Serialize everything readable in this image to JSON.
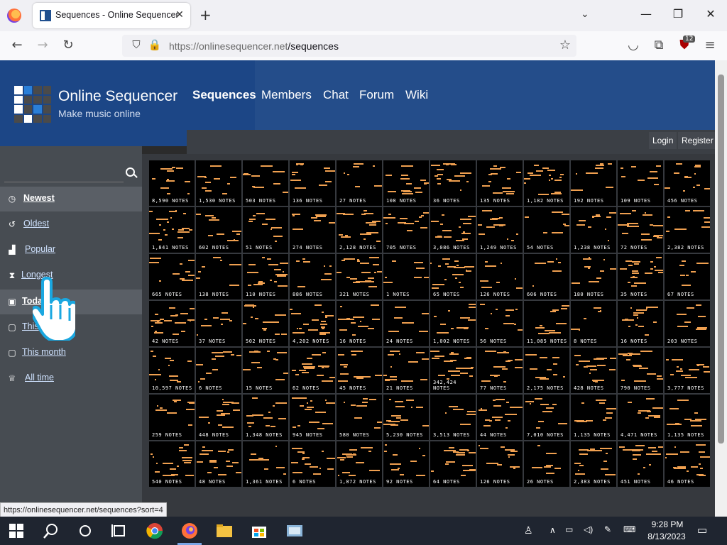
{
  "browser": {
    "tab_title": "Sequences - Online Sequencer",
    "url_host": "https://onlinesequencer.net",
    "url_path": "/sequences",
    "ext_badge": "12",
    "status_url": "https://onlinesequencer.net/sequences?sort=4"
  },
  "site": {
    "title": "Online Sequencer",
    "subtitle": "Make music online",
    "nav": [
      "Sequences",
      "Members",
      "Chat",
      "Forum",
      "Wiki"
    ],
    "login": "Login",
    "register": "Register"
  },
  "sidebar": {
    "search_placeholder": "",
    "items": [
      {
        "label": "Newest",
        "icon": "clock-icon",
        "selected": true
      },
      {
        "label": "Oldest",
        "icon": "history-icon",
        "selected": false
      },
      {
        "label": "Popular",
        "icon": "bar-chart-icon",
        "selected": false
      },
      {
        "label": "Longest",
        "icon": "hourglass-icon",
        "selected": false
      },
      {
        "label": "Today",
        "icon": "calendar-icon",
        "selected": true
      },
      {
        "label": "This",
        "icon": "calendar-icon",
        "selected": false
      },
      {
        "label": "This month",
        "icon": "calendar-icon",
        "selected": false
      },
      {
        "label": "All time",
        "icon": "trophy-icon",
        "selected": false
      }
    ]
  },
  "sequences": [
    "8,590 NOTES",
    "1,530 NOTES",
    "503 NOTES",
    "136 NOTES",
    "27 NOTES",
    "108 NOTES",
    "36 NOTES",
    "135 NOTES",
    "1,182 NOTES",
    "192 NOTES",
    "109 NOTES",
    "456 NOTES",
    "1,841 NOTES",
    "602 NOTES",
    "51 NOTES",
    "274 NOTES",
    "2,128 NOTES",
    "705 NOTES",
    "3,086 NOTES",
    "1,249 NOTES",
    "54 NOTES",
    "1,238 NOTES",
    "72 NOTES",
    "2,382 NOTES",
    "665 NOTES",
    "138 NOTES",
    "110 NOTES",
    "886 NOTES",
    "321 NOTES",
    "1 NOTES",
    "65 NOTES",
    "126 NOTES",
    "606 NOTES",
    "180 NOTES",
    "35 NOTES",
    "67 NOTES",
    "42 NOTES",
    "37 NOTES",
    "502 NOTES",
    "4,202 NOTES",
    "16 NOTES",
    "24 NOTES",
    "1,002 NOTES",
    "56 NOTES",
    "11,085 NOTES",
    "8 NOTES",
    "16 NOTES",
    "203 NOTES",
    "10,597 NOTES",
    "6 NOTES",
    "15 NOTES",
    "62 NOTES",
    "45 NOTES",
    "21 NOTES",
    "342,424 NOTES",
    "77 NOTES",
    "2,175 NOTES",
    "428 NOTES",
    "790 NOTES",
    "3,777 NOTES",
    "259 NOTES",
    "448 NOTES",
    "1,348 NOTES",
    "945 NOTES",
    "580 NOTES",
    "5,230 NOTES",
    "3,513 NOTES",
    "44 NOTES",
    "7,010 NOTES",
    "1,135 NOTES",
    "4,471 NOTES",
    "1,135 NOTES",
    "540 NOTES",
    "48 NOTES",
    "1,361 NOTES",
    "6 NOTES",
    "1,872 NOTES",
    "92 NOTES",
    "64 NOTES",
    "126 NOTES",
    "26 NOTES",
    "2,383 NOTES",
    "451 NOTES",
    "46 NOTES",
    "",
    "",
    "",
    "",
    "",
    "",
    ""
  ],
  "taskbar": {
    "time": "9:28 PM",
    "date": "8/13/2023"
  },
  "colors": {
    "header": "#244d8a",
    "sidebar": "#474c52",
    "note": "#f0a050"
  }
}
